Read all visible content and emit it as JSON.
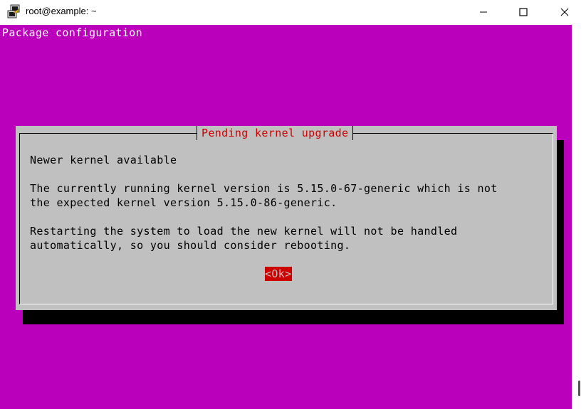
{
  "window": {
    "title": "root@example: ~",
    "app_icon": "putty-icon",
    "controls": [
      "minimize-icon",
      "maximize-icon",
      "close-icon"
    ]
  },
  "terminal": {
    "background_color": "#bb00bb",
    "header": "Package configuration"
  },
  "dialog": {
    "title": "Pending kernel upgrade",
    "lines": [
      "Newer kernel available",
      "",
      "The currently running kernel version is 5.15.0-67-generic which is not",
      "the expected kernel version 5.15.0-86-generic.",
      "",
      "Restarting the system to load the new kernel will not be handled",
      "automatically, so you should consider rebooting."
    ],
    "ok_button": "<Ok>",
    "colors": {
      "dialog_bg": "#c0c0c0",
      "title": "#cc0000",
      "button_bg": "#cc0000"
    }
  }
}
